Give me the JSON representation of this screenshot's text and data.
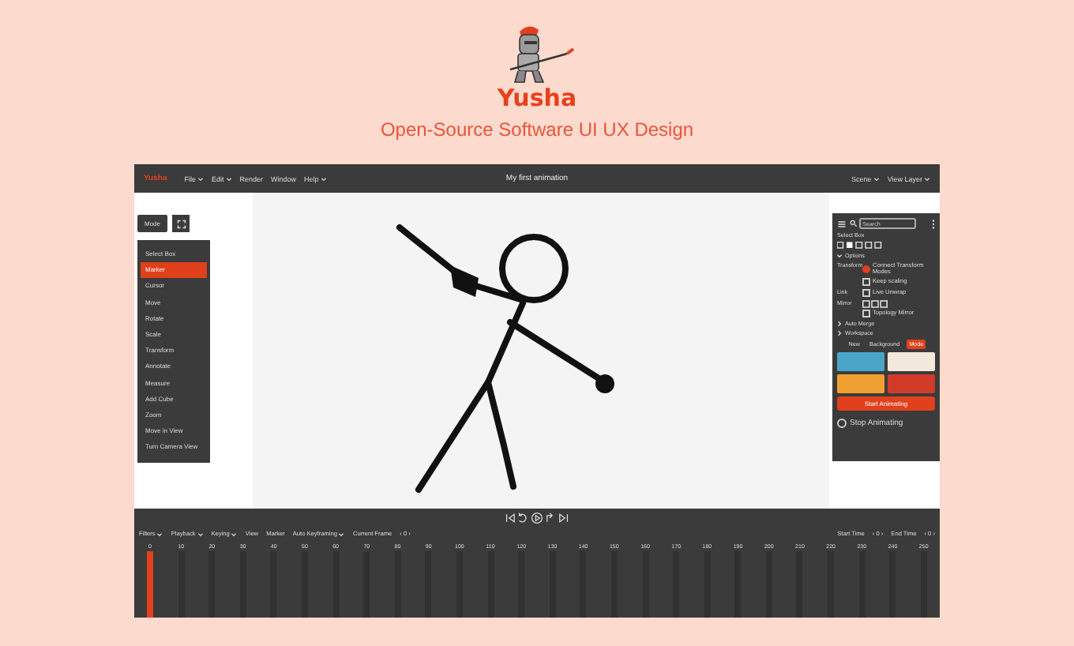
{
  "header": {
    "brand": "Yusha",
    "subtitle": "Open-Source Software UI UX Design"
  },
  "topbar": {
    "logo_text": "Yusha",
    "menus": [
      {
        "label": "File",
        "dropdown": true
      },
      {
        "label": "Edit",
        "dropdown": true
      },
      {
        "label": "Render",
        "dropdown": false
      },
      {
        "label": "Window",
        "dropdown": false
      },
      {
        "label": "Help",
        "dropdown": true
      }
    ],
    "title": "My first animation",
    "right_menus": [
      {
        "label": "Scene",
        "dropdown": true
      },
      {
        "label": "View Layer",
        "dropdown": true
      }
    ]
  },
  "mode_button": "Mode",
  "tools": [
    {
      "label": "Select Box",
      "selected": false
    },
    {
      "label": "Marker",
      "selected": true
    },
    {
      "label": "Cursor",
      "selected": false
    },
    {
      "label": "Move",
      "selected": false
    },
    {
      "label": "Rotate",
      "selected": false
    },
    {
      "label": "Scale",
      "selected": false
    },
    {
      "label": "Transform",
      "selected": false
    },
    {
      "label": "Annotate",
      "selected": false
    },
    {
      "label": "Measure",
      "selected": false
    },
    {
      "label": "Add Cube",
      "selected": false
    },
    {
      "label": "Zoom",
      "selected": false
    },
    {
      "label": "Move in View",
      "selected": false
    },
    {
      "label": "Turn Camera View",
      "selected": false
    }
  ],
  "right_panel": {
    "search": {
      "placeholder": "Search"
    },
    "select_label": "Select Box",
    "sections": [
      {
        "label": "Options",
        "expanded": true
      },
      {
        "label": "Auto Merge",
        "expanded": false
      },
      {
        "label": "Workspace",
        "expanded": false
      }
    ],
    "option_rows": [
      {
        "label": "Transform",
        "options": [
          {
            "label": "Connect Transform Modes",
            "checked": true
          },
          {
            "label": "Keep scaling",
            "checked": false
          }
        ]
      },
      {
        "label": "Link",
        "options": [
          {
            "label": "Live Unwrap",
            "checked": false
          }
        ]
      },
      {
        "label": "Mirror",
        "options": [
          {
            "label": "Topology Mirror",
            "checked": false
          }
        ]
      }
    ],
    "tabs": [
      {
        "label": "New",
        "selected": false
      },
      {
        "label": "Background",
        "selected": false
      },
      {
        "label": "Mode",
        "selected": true
      }
    ],
    "start_button": "Start Animating",
    "stop": {
      "label": "Stop Animating",
      "checked": false
    }
  },
  "timeline": {
    "menus": [
      {
        "label": "Filters",
        "dropdown": true
      },
      {
        "label": "Playback",
        "dropdown": true
      },
      {
        "label": "Keying",
        "dropdown": true
      },
      {
        "label": "View",
        "dropdown": false
      },
      {
        "label": "Marker",
        "dropdown": false
      },
      {
        "label": "Auto Keyframing",
        "dropdown": true
      }
    ],
    "current_frame": {
      "label": "Current Frame",
      "value": "‹ 0 ›"
    },
    "start_time": {
      "label": "Start Time",
      "value": "‹ 0 ›"
    },
    "end_time": {
      "label": "End Time",
      "value": "‹ 0 ›"
    },
    "frames": [
      {
        "label": "0",
        "selected": true
      },
      {
        "label": "10",
        "selected": false
      },
      {
        "label": "20",
        "selected": false
      },
      {
        "label": "30",
        "selected": false
      },
      {
        "label": "40",
        "selected": false
      },
      {
        "label": "50",
        "selected": false
      },
      {
        "label": "60",
        "selected": false
      },
      {
        "label": "70",
        "selected": false
      },
      {
        "label": "80",
        "selected": false
      },
      {
        "label": "90",
        "selected": false
      },
      {
        "label": "100",
        "selected": false
      },
      {
        "label": "110",
        "selected": false
      },
      {
        "label": "120",
        "selected": false
      },
      {
        "label": "130",
        "selected": false
      },
      {
        "label": "140",
        "selected": false
      },
      {
        "label": "150",
        "selected": false
      },
      {
        "label": "160",
        "selected": false
      },
      {
        "label": "170",
        "selected": false
      },
      {
        "label": "180",
        "selected": false
      },
      {
        "label": "190",
        "selected": false
      },
      {
        "label": "200",
        "selected": false
      },
      {
        "label": "210",
        "selected": false
      },
      {
        "label": "220",
        "selected": false
      },
      {
        "label": "230",
        "selected": false
      },
      {
        "label": "240",
        "selected": false
      },
      {
        "label": "250",
        "selected": false
      }
    ]
  }
}
